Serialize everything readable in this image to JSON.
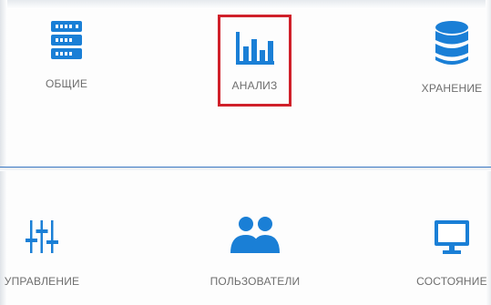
{
  "accent_color": "#1a7fd6",
  "selection_color": "#d0202a",
  "tiles_top": [
    {
      "label": "ОБЩИЕ",
      "icon": "server-rack-icon"
    },
    {
      "label": "АНАЛИЗ",
      "icon": "bar-chart-icon",
      "selected": true
    },
    {
      "label": "ХРАНЕНИЕ",
      "icon": "database-icon"
    }
  ],
  "tiles_bottom": [
    {
      "label": "УПРАВЛЕНИЕ",
      "icon": "sliders-icon"
    },
    {
      "label": "ПОЛЬЗОВАТЕЛИ",
      "icon": "users-icon"
    },
    {
      "label": "СОСТОЯНИЕ",
      "icon": "monitor-icon"
    }
  ]
}
